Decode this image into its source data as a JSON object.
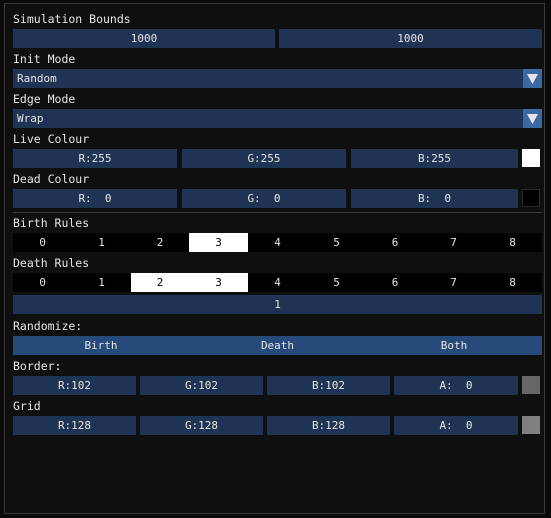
{
  "sim_bounds": {
    "label": "Simulation Bounds",
    "width": "1000",
    "height": "1000"
  },
  "init_mode": {
    "label": "Init Mode",
    "value": "Random"
  },
  "edge_mode": {
    "label": "Edge Mode",
    "value": "Wrap"
  },
  "live_colour": {
    "label": "Live Colour",
    "r": "R:255",
    "g": "G:255",
    "b": "B:255",
    "swatch": "#ffffff"
  },
  "dead_colour": {
    "label": "Dead Colour",
    "r": "R:  0",
    "g": "G:  0",
    "b": "B:  0",
    "swatch": "#000000"
  },
  "birth_rules": {
    "label": "Birth Rules",
    "cells": [
      "0",
      "1",
      "2",
      "3",
      "4",
      "5",
      "6",
      "7",
      "8"
    ],
    "active": [
      3
    ]
  },
  "death_rules": {
    "label": "Death Rules",
    "cells": [
      "0",
      "1",
      "2",
      "3",
      "4",
      "5",
      "6",
      "7",
      "8"
    ],
    "active": [
      2,
      3
    ]
  },
  "slider": {
    "value": "1"
  },
  "randomize": {
    "label": "Randomize:",
    "birth": "Birth",
    "death": "Death",
    "both": "Both"
  },
  "border": {
    "label": "Border:",
    "r": "R:102",
    "g": "G:102",
    "b": "B:102",
    "a": "A:  0",
    "swatch": "#666666"
  },
  "grid": {
    "label": "Grid",
    "r": "R:128",
    "g": "G:128",
    "b": "B:128",
    "a": "A:  0",
    "swatch": "#808080"
  },
  "colors": {
    "field_bg": "#1f3454",
    "accent": "#3b6aa3",
    "button": "#264a7a"
  },
  "icons": {
    "combo_arrow": "triangle-down-icon"
  }
}
